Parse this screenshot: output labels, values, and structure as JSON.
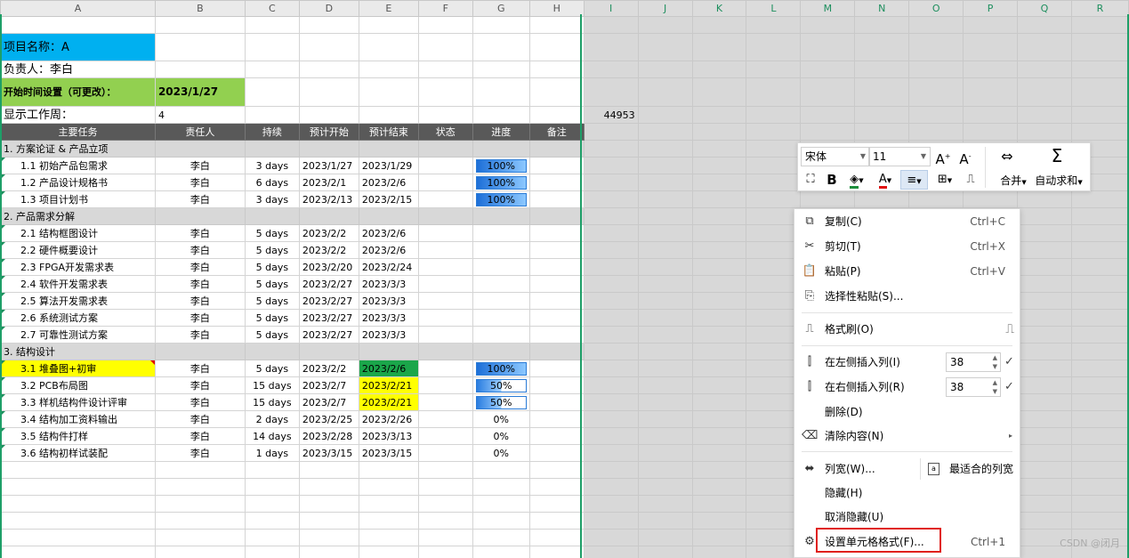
{
  "columns": [
    "A",
    "B",
    "C",
    "D",
    "E",
    "F",
    "G",
    "H",
    "I",
    "J",
    "K",
    "L",
    "M",
    "N",
    "O",
    "P",
    "Q",
    "R"
  ],
  "project": {
    "name_label": "项目名称：A",
    "owner_label": "负责人：李白",
    "start_label": "开始时间设置（可更改）：",
    "start_value": "2023/1/27",
    "week_label": "显示工作周：",
    "week_value": "4",
    "serial_value": "44953"
  },
  "table_headers": [
    "主要任务",
    "责任人",
    "持续",
    "预计开始",
    "预计结束",
    "状态",
    "进度",
    "备注"
  ],
  "rows": [
    {
      "type": "group",
      "task": "1. 方案论证 & 产品立项"
    },
    {
      "type": "task",
      "task": "1.1 初始产品包需求",
      "owner": "李白",
      "duration": "3 days",
      "start": "2023/1/27",
      "end": "2023/1/29",
      "progress": "100%"
    },
    {
      "type": "task",
      "task": "1.2 产品设计规格书",
      "owner": "李白",
      "duration": "6 days",
      "start": "2023/2/1",
      "end": "2023/2/6",
      "progress": "100%"
    },
    {
      "type": "task",
      "task": "1.3 项目计划书",
      "owner": "李白",
      "duration": "3 days",
      "start": "2023/2/13",
      "end": "2023/2/15",
      "progress": "100%"
    },
    {
      "type": "group",
      "task": "2. 产品需求分解"
    },
    {
      "type": "task",
      "task": "2.1 结构框图设计",
      "owner": "李白",
      "duration": "5 days",
      "start": "2023/2/2",
      "end": "2023/2/6",
      "progress": ""
    },
    {
      "type": "task",
      "task": "2.2 硬件概要设计",
      "owner": "李白",
      "duration": "5 days",
      "start": "2023/2/2",
      "end": "2023/2/6",
      "progress": ""
    },
    {
      "type": "task",
      "task": "2.3 FPGA开发需求表",
      "owner": "李白",
      "duration": "5 days",
      "start": "2023/2/20",
      "end": "2023/2/24",
      "progress": ""
    },
    {
      "type": "task",
      "task": "2.4 软件开发需求表",
      "owner": "李白",
      "duration": "5 days",
      "start": "2023/2/27",
      "end": "2023/3/3",
      "progress": ""
    },
    {
      "type": "task",
      "task": "2.5 算法开发需求表",
      "owner": "李白",
      "duration": "5 days",
      "start": "2023/2/27",
      "end": "2023/3/3",
      "progress": ""
    },
    {
      "type": "task",
      "task": "2.6 系统测试方案",
      "owner": "李白",
      "duration": "5 days",
      "start": "2023/2/27",
      "end": "2023/3/3",
      "progress": ""
    },
    {
      "type": "task",
      "task": "2.7 可靠性测试方案",
      "owner": "李白",
      "duration": "5 days",
      "start": "2023/2/27",
      "end": "2023/3/3",
      "progress": ""
    },
    {
      "type": "group",
      "task": "3. 结构设计"
    },
    {
      "type": "task",
      "task": "3.1 堆叠图+初审",
      "owner": "李白",
      "duration": "5 days",
      "start": "2023/2/2",
      "end": "2023/2/6",
      "progress": "100%",
      "taskbg": "#ffff00",
      "endbg": "#1aa64a"
    },
    {
      "type": "task",
      "task": "3.2 PCB布局图",
      "owner": "李白",
      "duration": "15 days",
      "start": "2023/2/7",
      "end": "2023/2/21",
      "progress": "50%",
      "endbg": "#ffff00"
    },
    {
      "type": "task",
      "task": "3.3 样机结构件设计评审",
      "owner": "李白",
      "duration": "15 days",
      "start": "2023/2/7",
      "end": "2023/2/21",
      "progress": "50%",
      "endbg": "#ffff00"
    },
    {
      "type": "task",
      "task": "3.4 结构加工资料输出",
      "owner": "李白",
      "duration": "2 days",
      "start": "2023/2/25",
      "end": "2023/2/26",
      "progress": "0%"
    },
    {
      "type": "task",
      "task": "3.5 结构件打样",
      "owner": "李白",
      "duration": "14 days",
      "start": "2023/2/28",
      "end": "2023/3/13",
      "progress": "0%"
    },
    {
      "type": "task",
      "task": "3.6 结构初样试装配",
      "owner": "李白",
      "duration": "1 days",
      "start": "2023/3/15",
      "end": "2023/3/15",
      "progress": "0%"
    }
  ],
  "mini_toolbar": {
    "font_name": "宋体",
    "font_size": "11",
    "merge_label": "合并",
    "autosum_label": "自动求和"
  },
  "context_menu": {
    "copy": "复制(C)",
    "copy_sc": "Ctrl+C",
    "cut": "剪切(T)",
    "cut_sc": "Ctrl+X",
    "paste": "粘贴(P)",
    "paste_sc": "Ctrl+V",
    "paste_special": "选择性粘贴(S)...",
    "format_painter": "格式刷(O)",
    "insert_left": "在左侧插入列(I)",
    "insert_left_val": "38",
    "insert_right": "在右侧插入列(R)",
    "insert_right_val": "38",
    "delete": "删除(D)",
    "clear": "清除内容(N)",
    "col_width": "列宽(W)...",
    "best_fit": "最适合的列宽",
    "hide": "隐藏(H)",
    "unhide": "取消隐藏(U)",
    "format_cells": "设置单元格格式(F)...",
    "format_cells_sc": "Ctrl+1"
  },
  "watermark": "CSDN @闭月",
  "colors": {
    "title_bg": "#00b0f0",
    "start_bg": "#92d050",
    "header_bg": "#595959",
    "group_bg": "#d8d8d8",
    "selection": "#1e9f68"
  }
}
